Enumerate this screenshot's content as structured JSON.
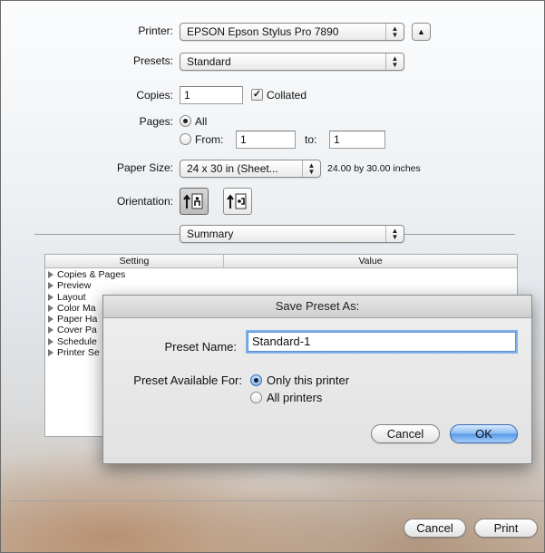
{
  "print_dialog": {
    "printer": {
      "label": "Printer:",
      "value": "EPSON Epson Stylus Pro 7890"
    },
    "presets": {
      "label": "Presets:",
      "value": "Standard"
    },
    "copies": {
      "label": "Copies:",
      "value": "1",
      "collated_label": "Collated",
      "collated_checked": true
    },
    "pages": {
      "label": "Pages:",
      "all_label": "All",
      "from_label": "From:",
      "from_value": "1",
      "to_label": "to:",
      "to_value": "1",
      "selected": "all"
    },
    "paper_size": {
      "label": "Paper Size:",
      "value": "24 x 30 in (Sheet...",
      "dimensions": "24.00 by 30.00 inches"
    },
    "orientation": {
      "label": "Orientation:",
      "selected": "portrait",
      "icons": [
        "portrait-icon",
        "landscape-icon"
      ]
    },
    "panel": {
      "value": "Summary"
    },
    "summary_table": {
      "headers": [
        "Setting",
        "Value"
      ],
      "rows": [
        "Copies & Pages",
        "Preview",
        "Layout",
        "Color Ma",
        "Paper Ha",
        "Cover Pa",
        "Schedule",
        "Printer Se"
      ]
    },
    "buttons": {
      "cancel": "Cancel",
      "print": "Print"
    }
  },
  "save_preset_dialog": {
    "title": "Save Preset As:",
    "preset_name_label": "Preset Name:",
    "preset_name_value": "Standard-1",
    "available_label": "Preset Available For:",
    "options": [
      "Only this printer",
      "All printers"
    ],
    "selected_option": "Only this printer",
    "cancel": "Cancel",
    "ok": "OK"
  },
  "colors": {
    "accent": "#5a9ae6",
    "focus_ring": "#7fb2ea"
  }
}
